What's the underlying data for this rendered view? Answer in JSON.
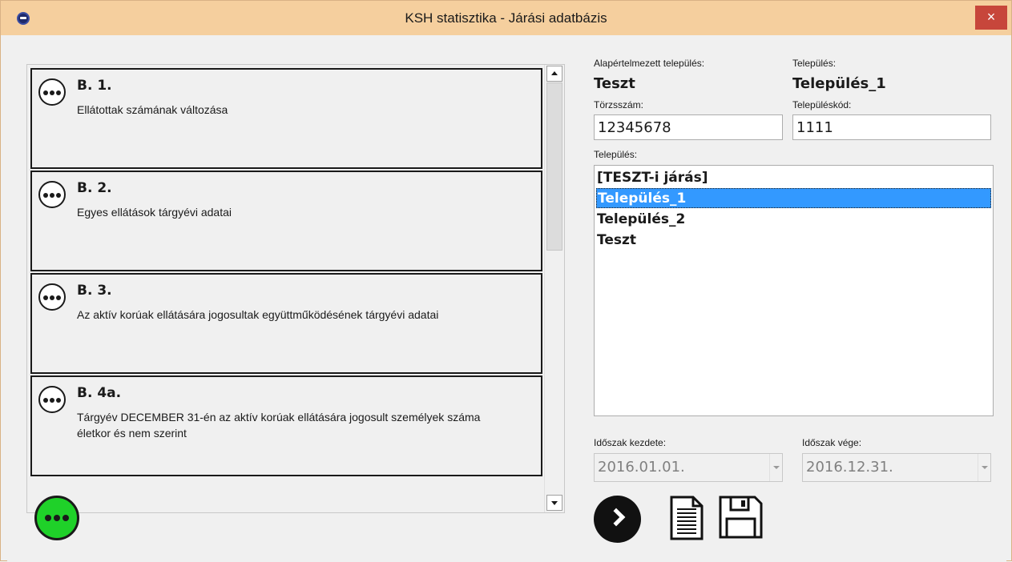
{
  "window": {
    "title": "KSH statisztika - Járási adatbázis",
    "close_label": "×"
  },
  "cards": [
    {
      "code": "B. 1.",
      "description": "Ellátottak számának változása"
    },
    {
      "code": "B. 2.",
      "description": "Egyes ellátások tárgyévi adatai"
    },
    {
      "code": "B. 3.",
      "description": "Az aktív korúak ellátására jogosultak együttműködésének tárgyévi adatai"
    },
    {
      "code": "B. 4a.",
      "description": "Tárgyév DECEMBER 31-én az aktív korúak ellátására jogosult személyek száma életkor és nem szerint"
    }
  ],
  "form": {
    "default_settlement_label": "Alapértelmezett település:",
    "default_settlement_value": "Teszt",
    "settlement_label": "Település:",
    "settlement_value": "Település_1",
    "registry_label": "Törzsszám:",
    "registry_value": "12345678",
    "settlement_code_label": "Településkód:",
    "settlement_code_value": "1111",
    "list_label": "Település:",
    "list_items": [
      "[TESZT-i járás]",
      "Település_1",
      "Település_2",
      "Teszt"
    ],
    "selected_item": "Település_1",
    "period_start_label": "Időszak kezdete:",
    "period_start_value": "2016.01.01.",
    "period_end_label": "Időszak vége:",
    "period_end_value": "2016.12.31."
  },
  "icons": {
    "app": "app-logo-icon",
    "more": "more-dots-icon",
    "next": "next-arrow-icon",
    "document": "document-icon",
    "save": "save-floppy-icon"
  },
  "colors": {
    "titlebar": "#f5cf9e",
    "close": "#c7463b",
    "selection": "#3399ff",
    "green_button": "#1fd129"
  }
}
